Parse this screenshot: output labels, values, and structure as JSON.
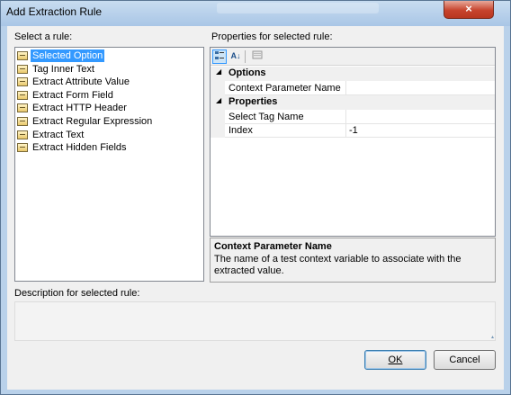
{
  "window": {
    "title": "Add Extraction Rule",
    "close_glyph": "×"
  },
  "rules_section": {
    "label": "Select a rule:",
    "items": [
      {
        "label": "Selected Option",
        "selected": true
      },
      {
        "label": "Tag Inner Text"
      },
      {
        "label": "Extract Attribute Value"
      },
      {
        "label": "Extract Form Field"
      },
      {
        "label": "Extract HTTP Header"
      },
      {
        "label": "Extract Regular Expression"
      },
      {
        "label": "Extract Text"
      },
      {
        "label": "Extract Hidden Fields"
      }
    ]
  },
  "properties_section": {
    "label": "Properties for selected rule:",
    "toolbar": {
      "categorized_icon": "categorized-icon",
      "alphabetical_icon": "sort-alpha-icon",
      "property_pages_icon": "property-pages-icon",
      "alpha_glyph": "A↓"
    },
    "categories": [
      {
        "name": "Options",
        "props": [
          {
            "name": "Context Parameter Name",
            "value": ""
          }
        ]
      },
      {
        "name": "Properties",
        "props": [
          {
            "name": "Select Tag Name",
            "value": ""
          },
          {
            "name": "Index",
            "value": "-1"
          }
        ]
      }
    ],
    "expand_glyph": "◢"
  },
  "help": {
    "title": "Context Parameter Name",
    "text": "The name of a test context variable to associate with the extracted value."
  },
  "description_section": {
    "label": "Description for selected rule:",
    "value": ""
  },
  "buttons": {
    "ok": "OK",
    "cancel": "Cancel"
  }
}
